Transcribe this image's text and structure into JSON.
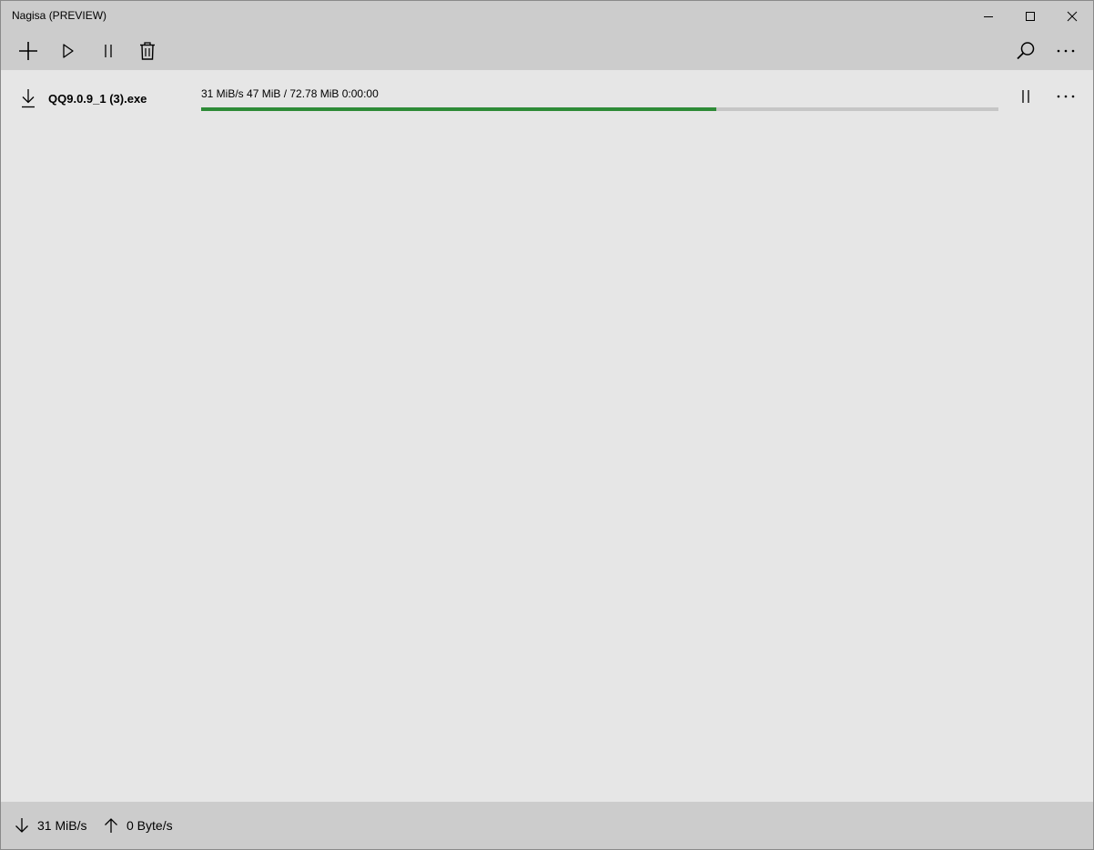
{
  "window": {
    "title": "Nagisa (PREVIEW)"
  },
  "titlebar": {
    "buttons": [
      "minimize-icon",
      "maximize-icon",
      "close-icon"
    ]
  },
  "toolbar": {
    "left_icons": [
      "add-icon",
      "play-icon",
      "pause-icon",
      "delete-icon"
    ],
    "right_icons": [
      "search-icon",
      "more-icon"
    ]
  },
  "downloads": [
    {
      "icon": "download-arrow-icon",
      "file_name": "QQ9.0.9_1 (3).exe",
      "status": "31 MiB/s 47 MiB / 72.78 MiB 0:00:00",
      "progress": 0.646,
      "progress_color": "#2e8b37",
      "actions": [
        "pause-icon",
        "more-icon"
      ]
    }
  ],
  "statusbar": {
    "download_speed": "31 MiB/s",
    "upload_speed": "0 Byte/s"
  },
  "colors": {
    "chrome": "#cccccc",
    "content": "#e6e6e6",
    "progress_track": "#c6c6c6",
    "accent": "#2e8b37"
  }
}
